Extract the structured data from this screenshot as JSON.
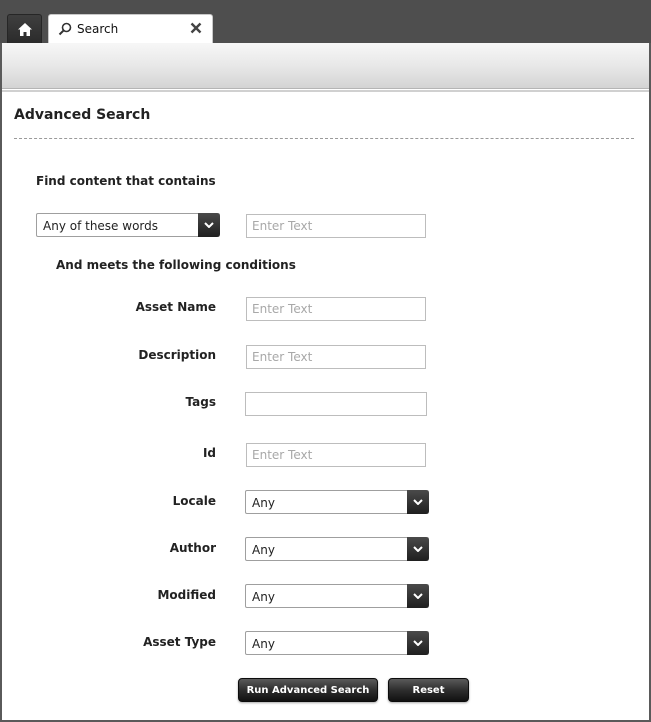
{
  "tabs": {
    "home_icon": "home-icon",
    "search_tab": {
      "label": "Search",
      "icon": "magnifier-icon",
      "close_icon": "close-icon"
    }
  },
  "page": {
    "title": "Advanced Search"
  },
  "find": {
    "label": "Find content that contains",
    "match_mode": "Any of these words",
    "text_placeholder": "Enter Text"
  },
  "conditions": {
    "label": "And meets the following conditions",
    "asset_name": {
      "label": "Asset Name",
      "placeholder": "Enter Text"
    },
    "description": {
      "label": "Description",
      "placeholder": "Enter Text"
    },
    "tags": {
      "label": "Tags",
      "placeholder": ""
    },
    "id": {
      "label": "Id",
      "placeholder": "Enter Text"
    },
    "locale": {
      "label": "Locale",
      "value": "Any"
    },
    "author": {
      "label": "Author",
      "value": "Any"
    },
    "modified": {
      "label": "Modified",
      "value": "Any"
    },
    "asset_type": {
      "label": "Asset Type",
      "value": "Any"
    }
  },
  "buttons": {
    "run": "Run Advanced Search",
    "reset": "Reset"
  },
  "colors": {
    "tab_bar": "#4e4e4e",
    "button": "#2e2e2e"
  }
}
